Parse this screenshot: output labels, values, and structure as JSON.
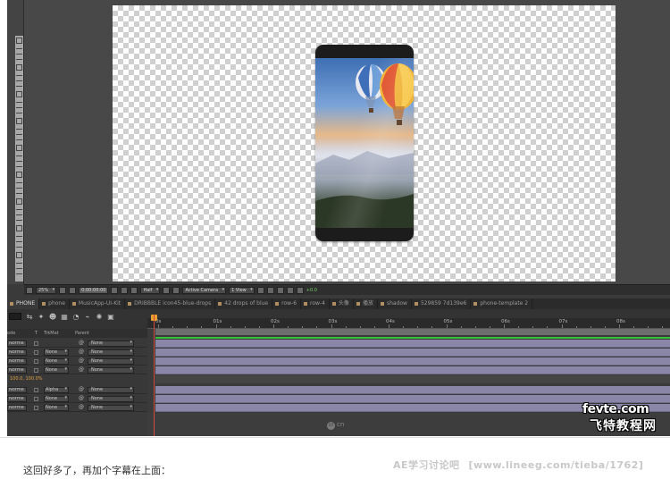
{
  "toolbar": {
    "zoom": "25%",
    "timecode": "0:00:00:00",
    "resolution": "Half",
    "camera": "Active Camera",
    "view": "1 View",
    "exposure": "+0.0"
  },
  "tabs": [
    "PHONE",
    "phone",
    "MusicApp-UI-Kit",
    "DRIBBBLE icon45-blue-drops",
    "42 drops of blue",
    "row-6",
    "row-4",
    "头像",
    "播放",
    "shadow",
    "529859 7d139e6",
    "phone-template 2"
  ],
  "timeline": {
    "ruler_labels": [
      "0s",
      "01s",
      "02s",
      "03s",
      "04s",
      "05s",
      "06s",
      "07s",
      "08s",
      "09s"
    ],
    "columns": {
      "mode": "ode",
      "t": "T",
      "trkmat": "TrkMat",
      "parent": "Parent"
    },
    "rows": [
      {
        "mode": "Norme",
        "trkmat": "",
        "parent": "None"
      },
      {
        "mode": "Norme",
        "trkmat": "None",
        "parent": "None"
      },
      {
        "mode": "Norme",
        "trkmat": "None",
        "parent": "None"
      },
      {
        "mode": "Norme",
        "trkmat": "None",
        "parent": "None"
      }
    ],
    "scale_value": "100.0, 100.0%",
    "rows2": [
      {
        "mode": "Norme",
        "trkmat": "Alpha",
        "parent": "None"
      },
      {
        "mode": "Norme",
        "trkmat": "None",
        "parent": "None"
      },
      {
        "mode": "Norme",
        "trkmat": "None",
        "parent": "None"
      }
    ]
  },
  "watermark": {
    "ui_badge": "UI",
    "ui_text": "cn"
  },
  "logo": {
    "line1": "fevte.com",
    "line2": "飞特教程网"
  },
  "caption": "这回好多了，再加个字幕在上面：",
  "footer": {
    "brand": "AE学习讨论吧",
    "url": "[www.lineeg.com/tieba/1762]"
  },
  "colors": {
    "track": "#8a86a8",
    "playhead": "#d04a3a",
    "work_area_line": "#38c038"
  }
}
